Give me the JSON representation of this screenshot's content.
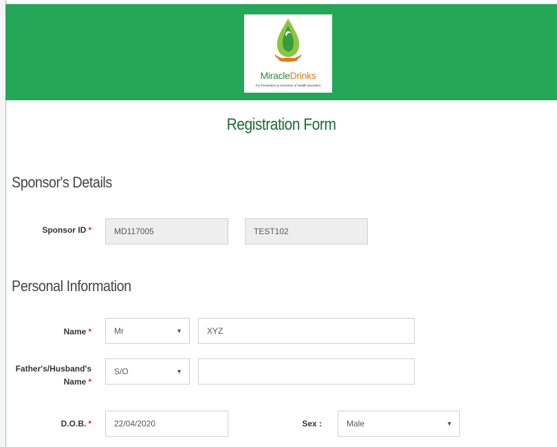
{
  "header": {
    "logo": {
      "brand_part1": "Miracle",
      "brand_part2": "Drinks",
      "tagline": "For Prevention & correction of Health Disorders"
    }
  },
  "form_title": "Registration Form",
  "sponsor_section": {
    "heading": "Sponsor's Details",
    "sponsor_id_label": "Sponsor ID",
    "sponsor_id_value": "MD117005",
    "sponsor_name_value": "TEST102"
  },
  "personal_section": {
    "heading": "Personal Information",
    "name_label": "Name",
    "title_value": "Mr",
    "name_value": "XYZ",
    "relation_label_line1": "Father's/Husband's",
    "relation_label_line2": "Name",
    "relation_value": "S/O",
    "relation_name_value": "",
    "dob_label": "D.O.B.",
    "dob_value": "22/04/2020",
    "sex_label": "Sex :",
    "sex_value": "Male"
  },
  "required_marker": "*",
  "dropdown_arrow": "▼",
  "colors": {
    "header_green": "#24a757",
    "title_green": "#1c6b3a",
    "required_red": "#e0281f"
  }
}
